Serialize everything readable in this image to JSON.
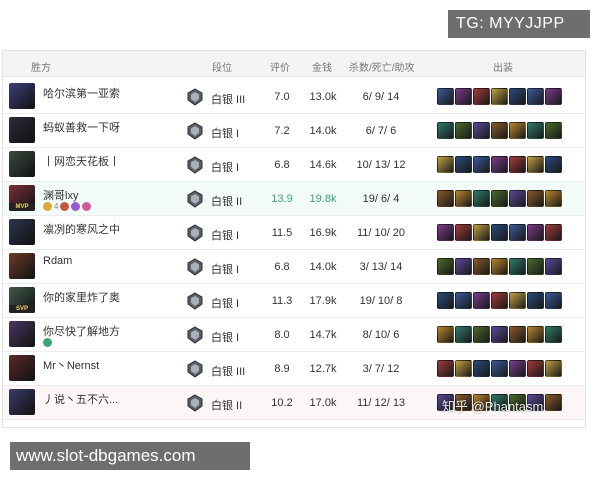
{
  "overlay": {
    "tg_label": "TG: MYYJJPP",
    "url_label": "www.slot-dbgames.com",
    "watermark": "知乎 @Phantasm"
  },
  "table": {
    "headers": {
      "team": "胜方",
      "rank": "段位",
      "score": "评价",
      "gold": "金钱",
      "kda": "杀数/死亡/助攻",
      "items": "出装"
    },
    "rows": [
      {
        "name": "哈尔滨第一亚索",
        "rank": "白银 III",
        "score": "7.0",
        "gold": "13.0k",
        "kda": "6/ 9/ 14",
        "avatar_color": "#3b3f7a"
      },
      {
        "name": "蚂蚁善救一下呀",
        "rank": "白银 I",
        "score": "7.2",
        "gold": "14.0k",
        "kda": "6/ 7/ 6",
        "avatar_color": "#2e2a3a"
      },
      {
        "name": "丨网恋天花板丨",
        "rank": "白银 I",
        "score": "6.8",
        "gold": "14.6k",
        "kda": "10/ 13/ 12",
        "avatar_color": "#3a4a3e"
      },
      {
        "name": "渊哥lxy",
        "rank": "白银 II",
        "score": "13.9",
        "gold": "19.8k",
        "kda": "19/ 6/ 4",
        "avatar_color": "#7a2f3a",
        "badge": "MVP",
        "highlight": true,
        "subline": "4"
      },
      {
        "name": "凛冽的寒风之中",
        "rank": "白银 I",
        "score": "11.5",
        "gold": "16.9k",
        "kda": "11/ 10/ 20",
        "avatar_color": "#2c3550"
      },
      {
        "name": "Rdam",
        "rank": "白银 I",
        "score": "6.8",
        "gold": "14.0k",
        "kda": "3/ 13/ 14",
        "avatar_color": "#6a3b2a"
      },
      {
        "name": "你的家里炸了奥",
        "rank": "白银 I",
        "score": "11.3",
        "gold": "17.9k",
        "kda": "19/ 10/ 8",
        "avatar_color": "#3f5a4a",
        "badge": "SVP"
      },
      {
        "name": "你尽快了解地方",
        "rank": "白银 I",
        "score": "8.0",
        "gold": "14.7k",
        "kda": "8/ 10/ 6",
        "avatar_color": "#4a3660",
        "small_badge": true
      },
      {
        "name": "Mr丶Nernst",
        "rank": "白银 III",
        "score": "8.9",
        "gold": "12.7k",
        "kda": "3/ 7/ 12",
        "avatar_color": "#5a2a2a"
      },
      {
        "name": "丿说丶五不六...",
        "rank": "白银 II",
        "score": "10.2",
        "gold": "17.0k",
        "kda": "11/ 12/ 13",
        "avatar_color": "#3a3a6a",
        "red": true
      }
    ]
  },
  "colors": {
    "header_bg": "#f4f4f4",
    "green": "#3aa573",
    "label_bg": "#6e6e6e"
  }
}
